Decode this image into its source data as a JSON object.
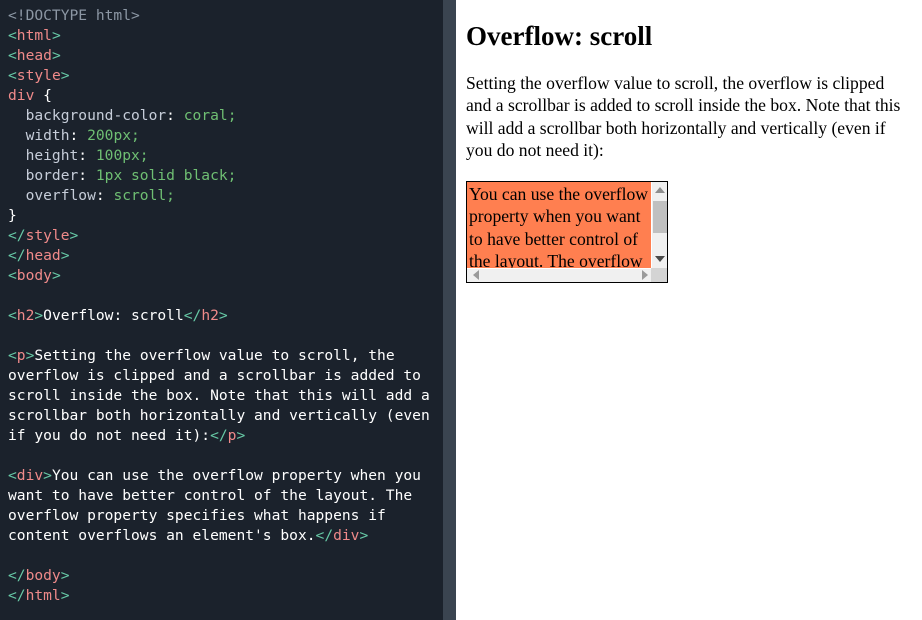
{
  "editor": {
    "language": "html",
    "background_color": "#1b222c",
    "scrollbar_color": "#3a4450",
    "code_lines": [
      [
        {
          "t": "doctype",
          "s": "<!DOCTYPE html>"
        }
      ],
      [
        {
          "t": "punc",
          "s": "<"
        },
        {
          "t": "tag",
          "s": "html"
        },
        {
          "t": "punc",
          "s": ">"
        }
      ],
      [
        {
          "t": "punc",
          "s": "<"
        },
        {
          "t": "tag",
          "s": "head"
        },
        {
          "t": "punc",
          "s": ">"
        }
      ],
      [
        {
          "t": "punc",
          "s": "<"
        },
        {
          "t": "tag",
          "s": "style"
        },
        {
          "t": "punc",
          "s": ">"
        }
      ],
      [
        {
          "t": "tag",
          "s": "div"
        },
        {
          "t": "brace",
          "s": " {"
        }
      ],
      [
        {
          "t": "prop",
          "s": "  background-color"
        },
        {
          "t": "plain",
          "s": ": "
        },
        {
          "t": "val",
          "s": "coral"
        },
        {
          "t": "val",
          "s": ";"
        }
      ],
      [
        {
          "t": "prop",
          "s": "  width"
        },
        {
          "t": "plain",
          "s": ": "
        },
        {
          "t": "val",
          "s": "200px;"
        }
      ],
      [
        {
          "t": "prop",
          "s": "  height"
        },
        {
          "t": "plain",
          "s": ": "
        },
        {
          "t": "val",
          "s": "100px;"
        }
      ],
      [
        {
          "t": "prop",
          "s": "  border"
        },
        {
          "t": "plain",
          "s": ": "
        },
        {
          "t": "val",
          "s": "1px solid black;"
        }
      ],
      [
        {
          "t": "prop",
          "s": "  overflow"
        },
        {
          "t": "plain",
          "s": ": "
        },
        {
          "t": "val",
          "s": "scroll;"
        }
      ],
      [
        {
          "t": "brace",
          "s": "}"
        }
      ],
      [
        {
          "t": "punc",
          "s": "</"
        },
        {
          "t": "tag",
          "s": "style"
        },
        {
          "t": "punc",
          "s": ">"
        }
      ],
      [
        {
          "t": "punc",
          "s": "</"
        },
        {
          "t": "tag",
          "s": "head"
        },
        {
          "t": "punc",
          "s": ">"
        }
      ],
      [
        {
          "t": "punc",
          "s": "<"
        },
        {
          "t": "tag",
          "s": "body"
        },
        {
          "t": "punc",
          "s": ">"
        }
      ],
      [
        {
          "t": "plain",
          "s": ""
        }
      ],
      [
        {
          "t": "punc",
          "s": "<"
        },
        {
          "t": "tag",
          "s": "h2"
        },
        {
          "t": "punc",
          "s": ">"
        },
        {
          "t": "plain",
          "s": "Overflow: scroll"
        },
        {
          "t": "punc",
          "s": "</"
        },
        {
          "t": "tag",
          "s": "h2"
        },
        {
          "t": "punc",
          "s": ">"
        }
      ],
      [
        {
          "t": "plain",
          "s": ""
        }
      ],
      [
        {
          "t": "punc",
          "s": "<"
        },
        {
          "t": "tag",
          "s": "p"
        },
        {
          "t": "punc",
          "s": ">"
        },
        {
          "t": "plain",
          "s": "Setting the overflow value to scroll, the overflow is clipped and a scrollbar is added to scroll inside the box. Note that this will add a scrollbar both horizontally and vertically (even if you do not need it):"
        },
        {
          "t": "punc",
          "s": "</"
        },
        {
          "t": "tag",
          "s": "p"
        },
        {
          "t": "punc",
          "s": ">"
        }
      ],
      [
        {
          "t": "plain",
          "s": ""
        }
      ],
      [
        {
          "t": "punc",
          "s": "<"
        },
        {
          "t": "tag",
          "s": "div"
        },
        {
          "t": "punc",
          "s": ">"
        },
        {
          "t": "plain",
          "s": "You can use the overflow property when you want to have better control of the layout. The overflow property specifies what happens if content overflows an element's box."
        },
        {
          "t": "punc",
          "s": "</"
        },
        {
          "t": "tag",
          "s": "div"
        },
        {
          "t": "punc",
          "s": ">"
        }
      ],
      [
        {
          "t": "plain",
          "s": ""
        }
      ],
      [
        {
          "t": "punc",
          "s": "</"
        },
        {
          "t": "tag",
          "s": "body"
        },
        {
          "t": "punc",
          "s": ">"
        }
      ],
      [
        {
          "t": "punc",
          "s": "</"
        },
        {
          "t": "tag",
          "s": "html"
        },
        {
          "t": "punc",
          "s": ">"
        }
      ]
    ]
  },
  "result": {
    "heading": "Overflow: scroll",
    "paragraph": "Setting the overflow value to scroll, the overflow is clipped and a scrollbar is added to scroll inside the box. Note that this will add a scrollbar both horizontally and vertically (even if you do not need it):",
    "demo_box": {
      "background_color": "#ff7f50",
      "border": "1px solid black",
      "width_px": "200px",
      "height_px": "100px",
      "overflow": "scroll",
      "text": "You can use the overflow property when you want to have better control of the layout. The overflow property specifies what happens if content overflows an element's box.",
      "vertical_scrollbar": {
        "up_arrow_icon": "triangle-up-icon",
        "down_arrow_icon": "triangle-down-icon",
        "thumb_color": "#c0c0c0",
        "track_color": "#f0f0f0"
      },
      "horizontal_scrollbar": {
        "left_arrow_icon": "triangle-left-icon",
        "right_arrow_icon": "triangle-right-icon",
        "track_color": "#f0f0f0"
      }
    }
  }
}
